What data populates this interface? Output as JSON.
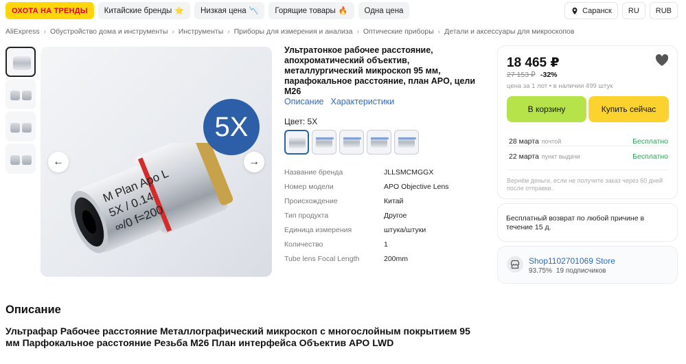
{
  "topbar": {
    "items": [
      {
        "label": "ОХОТА НА ТРЕНДЫ",
        "emoji": ""
      },
      {
        "label": "Китайские бренды",
        "emoji": "⭐"
      },
      {
        "label": "Низкая цена",
        "emoji": "📉"
      },
      {
        "label": "Горящие товары",
        "emoji": "🔥"
      },
      {
        "label": "Одна цена",
        "emoji": ""
      }
    ],
    "city": "Саранск",
    "lang": "RU",
    "currency": "RUB"
  },
  "breadcrumb": [
    "AliExpress",
    "Обустройство дома и инструменты",
    "Инструменты",
    "Приборы для измерения и анализа",
    "Оптические приборы",
    "Детали и аксессуары для микроскопов"
  ],
  "gallery": {
    "badge": "5X",
    "lens_text": [
      "M Plan Apo L",
      "5X / 0.14",
      "∞/0 f=200"
    ]
  },
  "product": {
    "title": "Ультратонкое рабочее расстояние, апохроматический объектив, металлургический микроскоп 95 мм, парафокальное расстояние, план APO, цели M26",
    "link_description": "Описание",
    "link_specs": "Характеристики",
    "color_label": "Цвет: 5X",
    "specs": [
      {
        "k": "Название бренда",
        "v": "JLLSMCMGGX"
      },
      {
        "k": "Номер модели",
        "v": "APO Objective Lens"
      },
      {
        "k": "Происхождение",
        "v": "Китай"
      },
      {
        "k": "Тип продукта",
        "v": "Другое"
      },
      {
        "k": "Единица измерения",
        "v": "штука/штуки"
      },
      {
        "k": "Количество",
        "v": "1"
      },
      {
        "k": "Tube lens Focal Length",
        "v": "200mm"
      }
    ]
  },
  "buybox": {
    "price": "18 465 ₽",
    "old_price": "27 153 ₽",
    "discount": "-32%",
    "info": "цена за 1 лот • в наличии 499 штук",
    "cart_label": "В корзину",
    "buy_label": "Купить сейчас",
    "delivery": [
      {
        "date": "28 марта",
        "method": "почтой",
        "cost": "Бесплатно"
      },
      {
        "date": "22 марта",
        "method": "пункт выдачи",
        "cost": "Бесплатно"
      }
    ],
    "refund_note": "Вернём деньги, если не получите заказ через 60 дней после отправки.",
    "return_text": "Бесплатный возврат по любой причине в течение 15 д."
  },
  "shop": {
    "name": "Shop1102701069 Store",
    "rating": "93.75%",
    "subscribers": "19 подписчиков"
  },
  "description": {
    "heading": "Описание",
    "text": "Ультрафар Рабочее расстояние Металлографический микроскоп с многослойным покрытием 95 мм Парфокальное расстояние Резьба M26 План интерфейса Объектив APO LWD"
  },
  "colors": {
    "accent": "#2f6ab7",
    "cart": "#b6e34a",
    "buy": "#fcd22e",
    "free": "#2aa05a",
    "trend_bg": "#ffd60a",
    "trend_text": "#e4002b"
  }
}
